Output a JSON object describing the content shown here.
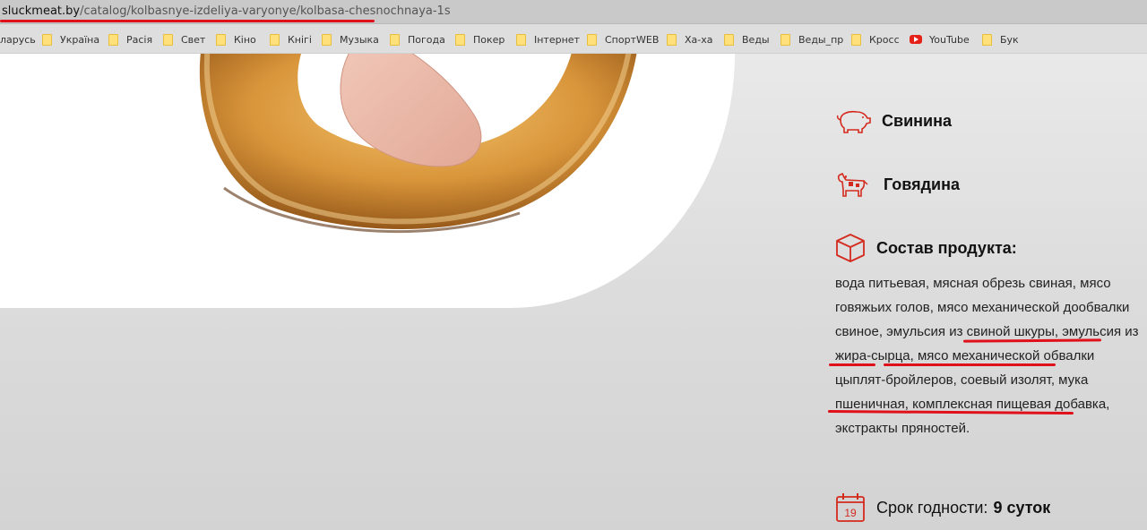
{
  "browser": {
    "url_domain": "sluckmeat.by",
    "url_path": "/catalog/kolbasnye-izdeliya-varyonye/kolbasa-chesnochnaya-1s",
    "bookmarks": [
      {
        "label": "ларусь",
        "icon": "none"
      },
      {
        "label": "Україна",
        "icon": "folder-icon"
      },
      {
        "label": "Расія",
        "icon": "folder-icon"
      },
      {
        "label": "Свет",
        "icon": "folder-icon"
      },
      {
        "label": "Кіно",
        "icon": "folder-icon"
      },
      {
        "label": "Кнігі",
        "icon": "folder-icon"
      },
      {
        "label": "Музыка",
        "icon": "folder-icon"
      },
      {
        "label": "Погода",
        "icon": "folder-icon"
      },
      {
        "label": "Покер",
        "icon": "folder-icon"
      },
      {
        "label": "Інтернет",
        "icon": "folder-icon"
      },
      {
        "label": "СпортWEB",
        "icon": "folder-icon"
      },
      {
        "label": "Ха-ха",
        "icon": "folder-icon"
      },
      {
        "label": "Веды",
        "icon": "folder-icon"
      },
      {
        "label": "Веды_пр",
        "icon": "folder-icon"
      },
      {
        "label": "Кросс",
        "icon": "folder-icon"
      },
      {
        "label": "YouTube",
        "icon": "youtube-icon"
      },
      {
        "label": "Бук",
        "icon": "folder-icon"
      }
    ]
  },
  "product": {
    "meat": [
      {
        "label": "Свинина",
        "icon": "pig-icon"
      },
      {
        "label": "Говядина",
        "icon": "cow-icon"
      }
    ],
    "composition_title": "Состав продукта:",
    "composition_icon": "box-icon",
    "composition": {
      "part1": "вода питьевая, мясная обрезь свиная, мясо говяжьих голов, мясо механической дообвалки свиное, ",
      "hl1": "эмульсия из свиной шкуры",
      "part2": ", ",
      "hl2": "эмульсия из жира-сырца",
      "part3": ", мясо механической обвалки цыплят-бройлеров, ",
      "hl3": "соевый изолят, мука пшеничная,",
      "part4": " комплексная пищевая добавка, экстракты пряностей."
    },
    "shelf_label": "Срок годности:",
    "shelf_value": "9 суток",
    "shelf_icon_number": "19"
  },
  "colors": {
    "accent": "#e0101a",
    "icon_red": "#d42a1e"
  }
}
